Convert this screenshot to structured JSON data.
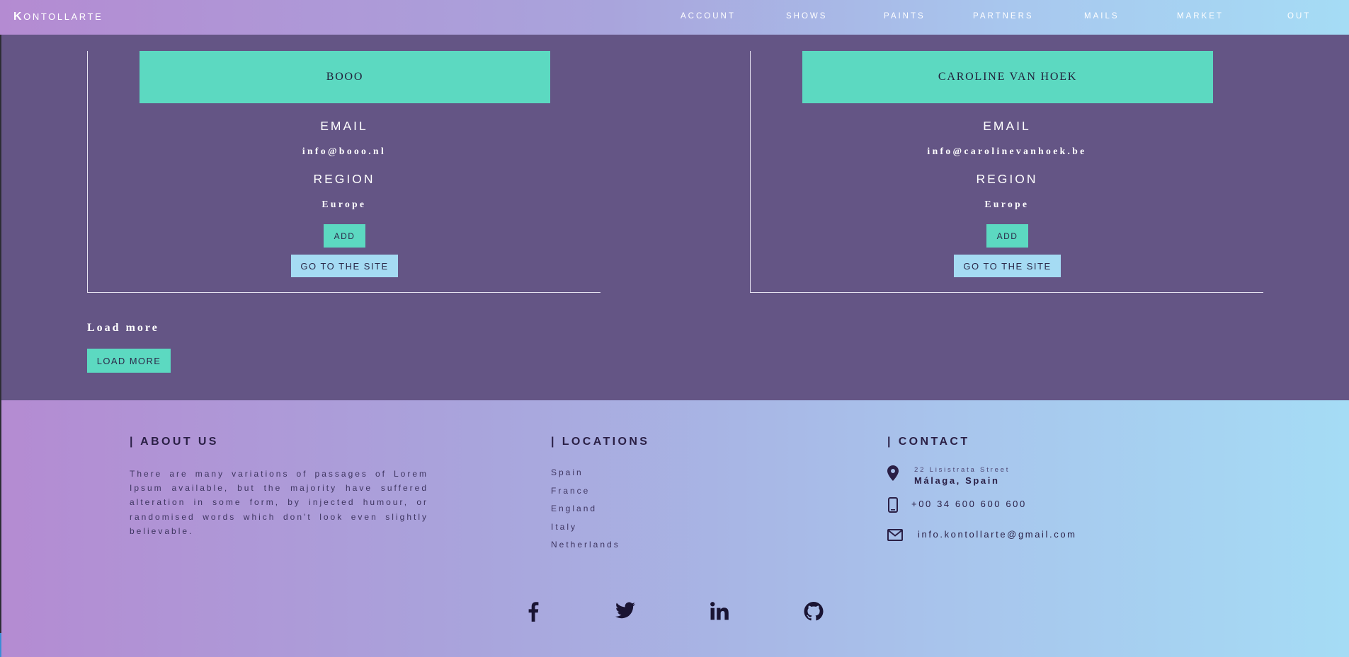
{
  "nav": {
    "brand": "Kontollarte",
    "items": [
      {
        "label": "ACCOUNT",
        "name": "nav-account"
      },
      {
        "label": "SHOWS",
        "name": "nav-shows"
      },
      {
        "label": "PAINTS",
        "name": "nav-paints"
      },
      {
        "label": "PARTNERS",
        "name": "nav-partners"
      },
      {
        "label": "MAILS",
        "name": "nav-mails"
      },
      {
        "label": "MARKET",
        "name": "nav-market"
      },
      {
        "label": "OUT",
        "name": "nav-out"
      }
    ]
  },
  "partners": [
    {
      "name": "BOOO",
      "email_label": "EMAIL",
      "email": "info@booo.nl",
      "region_label": "REGION",
      "region": "Europe",
      "add_label": "ADD",
      "site_label": "GO TO THE SITE"
    },
    {
      "name": "CAROLINE VAN HOEK",
      "email_label": "EMAIL",
      "email": "info@carolinevanhoek.be",
      "region_label": "REGION",
      "region": "Europe",
      "add_label": "ADD",
      "site_label": "GO TO THE SITE"
    }
  ],
  "load_more": {
    "title": "Load more",
    "button": "LOAD MORE"
  },
  "footer": {
    "about": {
      "heading": "| ABOUT US",
      "text": "There are many variations of passages of Lorem Ipsum available, but the majority have suffered alteration in some form, by injected humour, or randomised words which don't look even slightly believable."
    },
    "locations": {
      "heading": "| LOCATIONS",
      "items": [
        "Spain",
        "France",
        "England",
        "Italy",
        "Netherlands"
      ]
    },
    "contact": {
      "heading": "| CONTACT",
      "street": "22 Lisistrata Street",
      "city": "Málaga, Spain",
      "phone": "+00 34 600 600 600",
      "email": "info.kontollarte@gmail.com"
    },
    "social": [
      "facebook-icon",
      "twitter-icon",
      "linkedin-icon",
      "github-icon"
    ]
  },
  "colors": {
    "background": "#645585",
    "accent": "#5cd9c1",
    "site_button": "#a5dbf3",
    "gradient_start": "#b48bd2",
    "gradient_end": "#a5dcf5",
    "footer_text": "#2a1f45"
  }
}
